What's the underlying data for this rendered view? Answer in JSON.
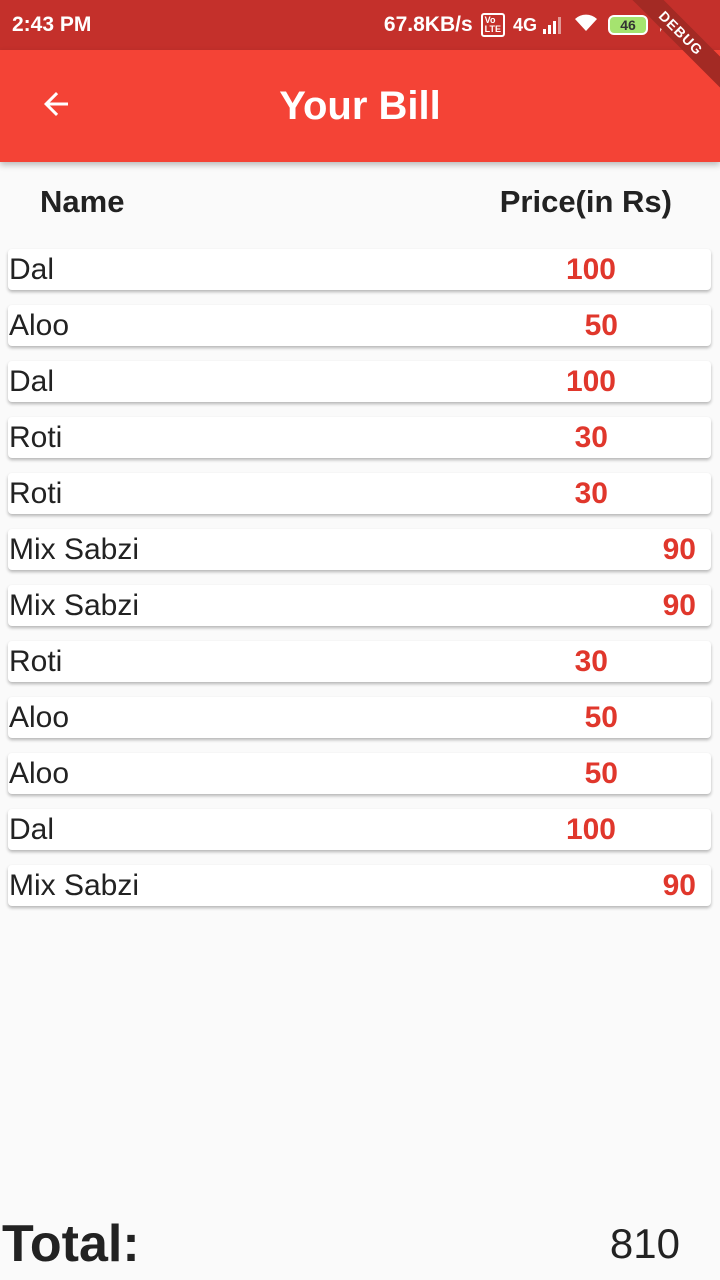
{
  "status_bar": {
    "time": "2:43 PM",
    "network_speed": "67.8KB/s",
    "lte_label": "VoLTE",
    "signal_label": "4G",
    "battery": "46"
  },
  "debug_banner": "DEBUG",
  "app_bar": {
    "title": "Your Bill",
    "back_icon": "arrow-back-icon"
  },
  "columns": {
    "name": "Name",
    "price": "Price(in Rs)"
  },
  "items": [
    {
      "name": "Dal",
      "price": "100"
    },
    {
      "name": "Aloo",
      "price": "50"
    },
    {
      "name": "Dal",
      "price": "100"
    },
    {
      "name": "Roti",
      "price": "30"
    },
    {
      "name": "Roti",
      "price": "30"
    },
    {
      "name": "Mix Sabzi",
      "price": "90"
    },
    {
      "name": "Mix Sabzi",
      "price": "90"
    },
    {
      "name": "Roti",
      "price": "30"
    },
    {
      "name": "Aloo",
      "price": "50"
    },
    {
      "name": "Aloo",
      "price": "50"
    },
    {
      "name": "Dal",
      "price": "100"
    },
    {
      "name": "Mix Sabzi",
      "price": "90"
    }
  ],
  "total": {
    "label": "Total:",
    "value": "810"
  },
  "colors": {
    "app_bar": "#f44336",
    "status_bar": "#c4302b",
    "price": "#e0372c"
  }
}
